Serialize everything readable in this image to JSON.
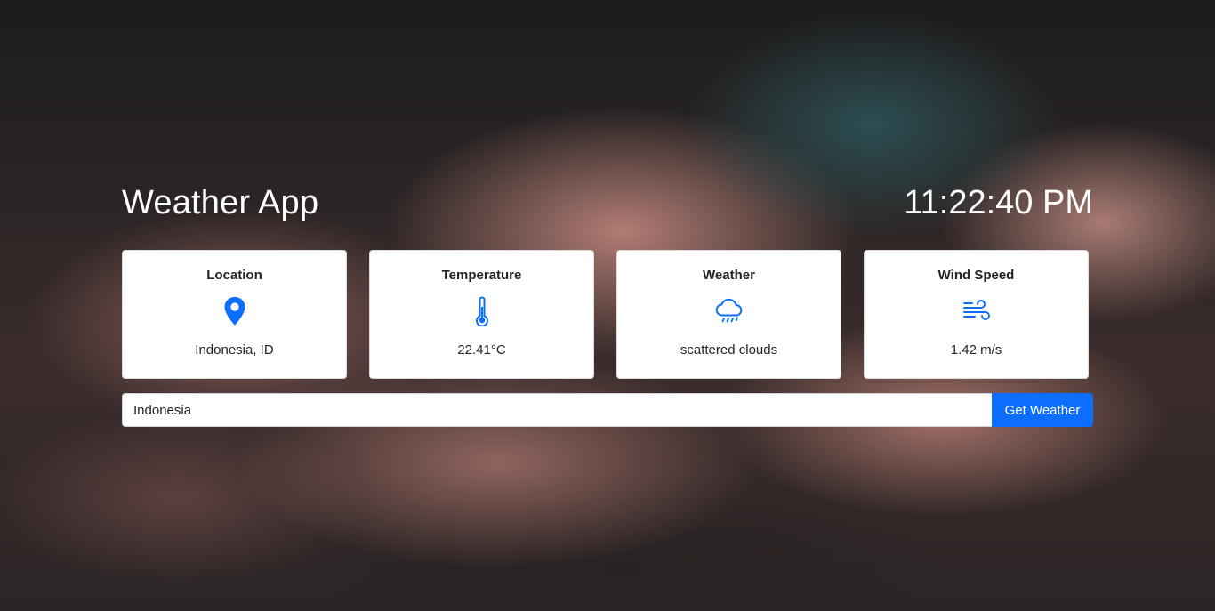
{
  "app": {
    "title": "Weather App",
    "clock": "11:22:40 PM"
  },
  "cards": [
    {
      "title": "Location",
      "icon": "location-pin-icon",
      "value": "Indonesia, ID"
    },
    {
      "title": "Temperature",
      "icon": "thermometer-icon",
      "value": "22.41°C"
    },
    {
      "title": "Weather",
      "icon": "cloud-rain-icon",
      "value": "scattered clouds"
    },
    {
      "title": "Wind Speed",
      "icon": "wind-icon",
      "value": "1.42 m/s"
    }
  ],
  "search": {
    "value": "Indonesia",
    "button_label": "Get Weather"
  },
  "colors": {
    "accent": "#0d6efd",
    "card_bg": "#ffffff",
    "text": "#212529"
  }
}
